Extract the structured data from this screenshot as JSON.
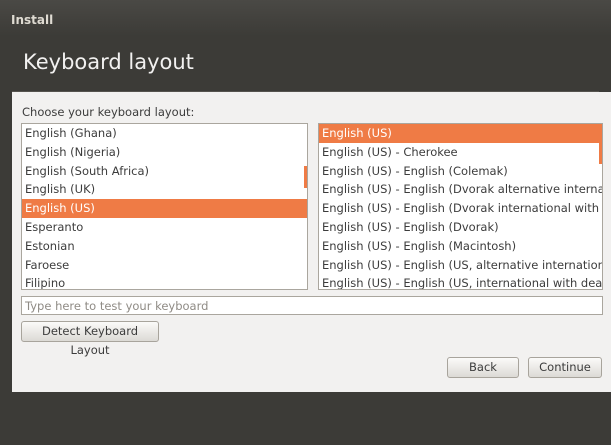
{
  "window": {
    "title": "Install"
  },
  "header": {
    "title": "Keyboard layout"
  },
  "prompt": "Choose your keyboard layout:",
  "layouts": {
    "items": [
      "English (Ghana)",
      "English (Nigeria)",
      "English (South Africa)",
      "English (UK)",
      "English (US)",
      "Esperanto",
      "Estonian",
      "Faroese",
      "Filipino"
    ],
    "selected": "English (US)"
  },
  "variants": {
    "items": [
      "English (US)",
      "English (US) - Cherokee",
      "English (US) - English (Colemak)",
      "English (US) - English (Dvorak alternative international",
      "English (US) - English (Dvorak international with dead",
      "English (US) - English (Dvorak)",
      "English (US) - English (Macintosh)",
      "English (US) - English (US, alternative international)",
      "English (US) - English (US, international with dead key"
    ],
    "selected": "English (US)"
  },
  "test_input": {
    "value": "",
    "placeholder": "Type here to test your keyboard"
  },
  "buttons": {
    "detect": "Detect Keyboard Layout",
    "back": "Back",
    "continue": "Continue"
  },
  "colors": {
    "accent": "#ef7b45",
    "background": "#3c3b37",
    "panel": "#f2f1f0"
  }
}
